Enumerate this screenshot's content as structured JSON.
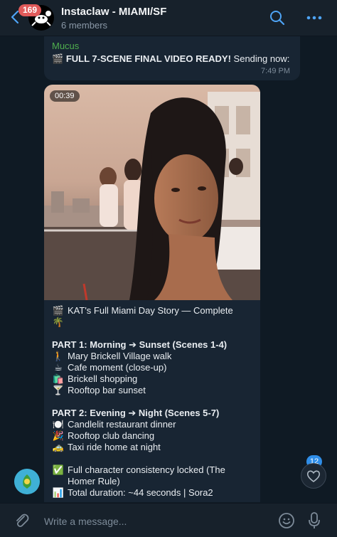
{
  "header": {
    "unread_count": "169",
    "title": "Instaclaw - MIAMI/SF",
    "subtitle": "6 members",
    "icons": [
      "back-arrow-icon",
      "search-icon",
      "more-icon"
    ]
  },
  "messages": [
    {
      "sender": "Mucus",
      "sender_color": "#4fae4e",
      "emoji": "🎬",
      "bold": "FULL 7-SCENE FINAL VIDEO READY!",
      "rest": "Sending now:",
      "time": "7:49 PM"
    },
    {
      "video_duration": "00:39",
      "lines": [
        {
          "emoji": "🎬",
          "text": "KAT's Full Miami Day Story — Complete"
        },
        {
          "emoji": "🌴",
          "text": ""
        },
        {
          "gap": true
        },
        {
          "bold": true,
          "text": "PART 1: Morning ➔ Sunset (Scenes 1-4)"
        },
        {
          "emoji": "🚶",
          "text": "Mary Brickell Village walk"
        },
        {
          "emoji": "☕",
          "text": "Cafe moment (close-up)"
        },
        {
          "emoji": "🛍️",
          "text": "Brickell shopping"
        },
        {
          "emoji": "🍸",
          "text": "Rooftop bar sunset"
        },
        {
          "gap": true
        },
        {
          "bold": true,
          "text": "PART 2: Evening ➔ Night (Scenes 5-7)"
        },
        {
          "emoji": "🍽️",
          "text": "Candlelit restaurant dinner"
        },
        {
          "emoji": "🎉",
          "text": "Rooftop club dancing"
        },
        {
          "emoji": "🚕",
          "text": "Taxi ride home at night"
        },
        {
          "gap": true
        },
        {
          "emoji": "✅",
          "text": "Full character consistency locked (The"
        },
        {
          "emoji": "",
          "text": "Homer Rule)"
        },
        {
          "emoji": "📊",
          "text": "Total duration: ~44 seconds | Sora2"
        }
      ]
    }
  ],
  "reaction": {
    "count": "12",
    "icon": "heart-icon"
  },
  "composer": {
    "placeholder": "Write a message..."
  },
  "colors": {
    "accent": "#2f8ee8",
    "badge": "#e05a5a",
    "bubble": "#182533",
    "background": "#0f1a24"
  }
}
